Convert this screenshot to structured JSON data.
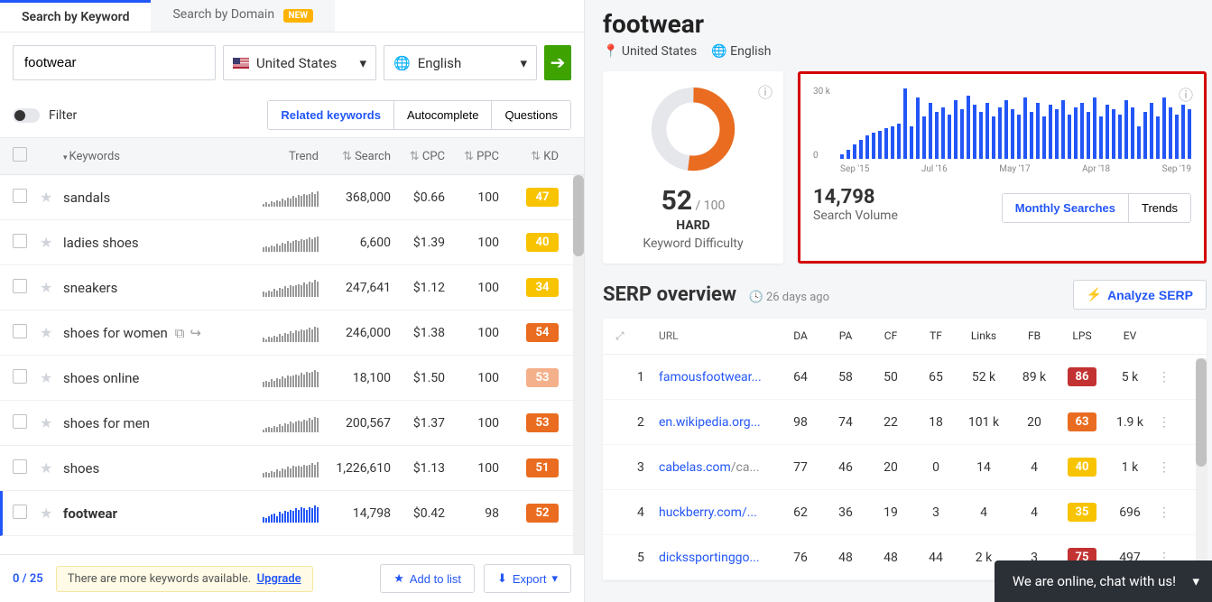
{
  "tabs": {
    "keyword": "Search by Keyword",
    "domain": "Search by Domain",
    "new_badge": "NEW"
  },
  "search": {
    "value": "footwear",
    "country": "United States",
    "language": "English"
  },
  "filter": {
    "label": "Filter",
    "related": "Related keywords",
    "autocomplete": "Autocomplete",
    "questions": "Questions"
  },
  "table_head": {
    "keywords": "Keywords",
    "trend": "Trend",
    "search": "Search",
    "cpc": "CPC",
    "ppc": "PPC",
    "kd": "KD"
  },
  "rows": [
    {
      "kw": "footwear",
      "search": "14,798",
      "cpc": "$0.42",
      "ppc": "98",
      "kd": "52",
      "kd_color": "kd-orange",
      "active": true,
      "trend": [
        4,
        3,
        5,
        6,
        7,
        5,
        8,
        7,
        9,
        8,
        10,
        9,
        11,
        10,
        12,
        11,
        10,
        12,
        11,
        13,
        12
      ]
    },
    {
      "kw": "shoes",
      "search": "1,226,610",
      "cpc": "$1.13",
      "ppc": "100",
      "kd": "51",
      "kd_color": "kd-orange",
      "trend": [
        3,
        4,
        3,
        5,
        4,
        6,
        5,
        7,
        6,
        8,
        7,
        9,
        8,
        9,
        8,
        10,
        9,
        10,
        11,
        10,
        12
      ]
    },
    {
      "kw": "shoes for men",
      "search": "200,567",
      "cpc": "$1.37",
      "ppc": "100",
      "kd": "53",
      "kd_color": "kd-orange",
      "trend": [
        2,
        3,
        4,
        3,
        5,
        4,
        6,
        5,
        7,
        6,
        8,
        7,
        8,
        9,
        8,
        10,
        9,
        11,
        10,
        12,
        11
      ]
    },
    {
      "kw": "shoes online",
      "search": "18,100",
      "cpc": "$1.50",
      "ppc": "100",
      "kd": "53",
      "kd_color": "kd-orange-light",
      "trend": [
        4,
        5,
        4,
        6,
        5,
        7,
        6,
        8,
        7,
        9,
        8,
        9,
        10,
        9,
        11,
        10,
        12,
        11,
        12,
        13,
        12
      ]
    },
    {
      "kw": "shoes for women",
      "search": "246,000",
      "cpc": "$1.38",
      "ppc": "100",
      "kd": "54",
      "kd_color": "kd-orange",
      "show_actions": true,
      "trend": [
        3,
        2,
        4,
        3,
        5,
        4,
        6,
        5,
        7,
        6,
        8,
        7,
        9,
        8,
        10,
        9,
        10,
        11,
        10,
        12,
        11
      ]
    },
    {
      "kw": "sneakers",
      "search": "247,641",
      "cpc": "$1.12",
      "ppc": "100",
      "kd": "34",
      "kd_color": "kd-yellow",
      "trend": [
        4,
        3,
        5,
        4,
        6,
        5,
        7,
        6,
        8,
        7,
        9,
        8,
        9,
        10,
        9,
        11,
        10,
        12,
        11,
        13,
        12
      ]
    },
    {
      "kw": "ladies shoes",
      "search": "6,600",
      "cpc": "$1.39",
      "ppc": "100",
      "kd": "40",
      "kd_color": "kd-yellow",
      "trend": [
        3,
        4,
        3,
        5,
        4,
        6,
        5,
        7,
        6,
        8,
        7,
        8,
        9,
        8,
        10,
        9,
        10,
        11,
        10,
        11,
        12
      ]
    },
    {
      "kw": "sandals",
      "search": "368,000",
      "cpc": "$0.66",
      "ppc": "100",
      "kd": "47",
      "kd_color": "kd-yellow",
      "trend": [
        2,
        3,
        2,
        4,
        3,
        5,
        4,
        6,
        5,
        7,
        6,
        8,
        7,
        9,
        8,
        10,
        9,
        10,
        11,
        10,
        12
      ]
    }
  ],
  "bottom": {
    "page": "0 / 25",
    "notice_text": "There are more keywords available.",
    "upgrade": "Upgrade",
    "add": "Add to list",
    "export": "Export"
  },
  "right": {
    "title": "footwear",
    "country": "United States",
    "language": "English",
    "kd": {
      "score": "52",
      "max": "/ 100",
      "hard": "HARD",
      "label": "Keyword Difficulty"
    },
    "chart": {
      "y_top": "30 k",
      "y_bottom": "0",
      "x": [
        "Sep '15",
        "Jul '16",
        "May '17",
        "Apr '18",
        "Sep '19"
      ],
      "volume": "14,798",
      "volume_label": "Search Volume",
      "tab1": "Monthly Searches",
      "tab2": "Trends"
    }
  },
  "chart_data": {
    "type": "bar",
    "title": "Monthly Searches",
    "ylabel": "search volume",
    "ylim": [
      0,
      30000
    ],
    "x_start": "Sep 2015",
    "x_end": "Sep 2019",
    "values": [
      2000,
      4000,
      6000,
      8000,
      10000,
      11000,
      12000,
      13000,
      14000,
      15000,
      30000,
      14000,
      26000,
      18000,
      24000,
      20000,
      22000,
      19000,
      25000,
      21000,
      27000,
      23000,
      20000,
      24000,
      18000,
      22000,
      25000,
      21000,
      19000,
      26000,
      20000,
      24000,
      18000,
      23000,
      21000,
      25000,
      19000,
      22000,
      24000,
      20000,
      26000,
      18000,
      23000,
      21000,
      19000,
      25000,
      22000,
      14000,
      20000,
      24000,
      18000,
      26000,
      22000,
      19000,
      23000,
      21000
    ]
  },
  "serp": {
    "title": "SERP overview",
    "age": "26 days ago",
    "analyze": "Analyze SERP",
    "head": {
      "url": "URL",
      "da": "DA",
      "pa": "PA",
      "cf": "CF",
      "tf": "TF",
      "links": "Links",
      "fb": "FB",
      "lps": "LPS",
      "ev": "EV"
    },
    "rows": [
      {
        "idx": "1",
        "url": "famousfootwear...",
        "da": "64",
        "pa": "58",
        "cf": "50",
        "tf": "65",
        "links": "52 k",
        "fb": "89 k",
        "lps": "86",
        "lps_color": "lps-red",
        "ev": "5 k"
      },
      {
        "idx": "2",
        "url": "en.wikipedia.org...",
        "da": "98",
        "pa": "74",
        "cf": "22",
        "tf": "18",
        "links": "101 k",
        "fb": "20",
        "lps": "63",
        "lps_color": "lps-orange",
        "ev": "1.9 k"
      },
      {
        "idx": "3",
        "url": "cabelas.com",
        "url_tail": "/ca...",
        "da": "77",
        "pa": "46",
        "cf": "20",
        "tf": "0",
        "links": "14",
        "fb": "4",
        "lps": "40",
        "lps_color": "lps-yellow",
        "ev": "1 k"
      },
      {
        "idx": "4",
        "url": "huckberry.com/...",
        "da": "62",
        "pa": "36",
        "cf": "19",
        "tf": "3",
        "links": "4",
        "fb": "4",
        "lps": "35",
        "lps_color": "lps-yellow",
        "ev": "696"
      },
      {
        "idx": "5",
        "url": "dickssportinggo...",
        "da": "76",
        "pa": "48",
        "cf": "48",
        "tf": "44",
        "links": "2 k",
        "fb": "3",
        "lps": "75",
        "lps_color": "lps-red",
        "ev": "497"
      }
    ]
  },
  "chat": "We are online, chat with us!"
}
